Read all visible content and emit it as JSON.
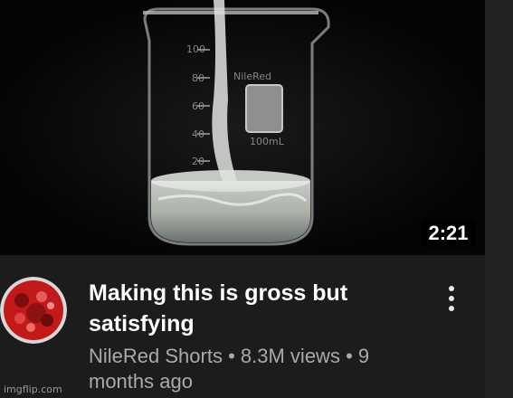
{
  "video": {
    "duration": "2:21",
    "title_line1": "Making this is gross but",
    "title_line2": "satisfying",
    "channel": "NileRed Shorts",
    "separator": "•",
    "views": "8.3M views",
    "age_part1": "9",
    "age_part2": "months ago"
  },
  "thumbnail": {
    "beaker_brand": "NileRed",
    "beaker_marks": [
      "100",
      "80",
      "60",
      "40",
      "20"
    ],
    "beaker_volume": "100mL"
  },
  "watermark": "imgflip.com",
  "colors": {
    "background": "#1c1c1c",
    "title": "#ffffff",
    "meta": "#aaaaaa",
    "avatar_red": "#c21a1a"
  }
}
